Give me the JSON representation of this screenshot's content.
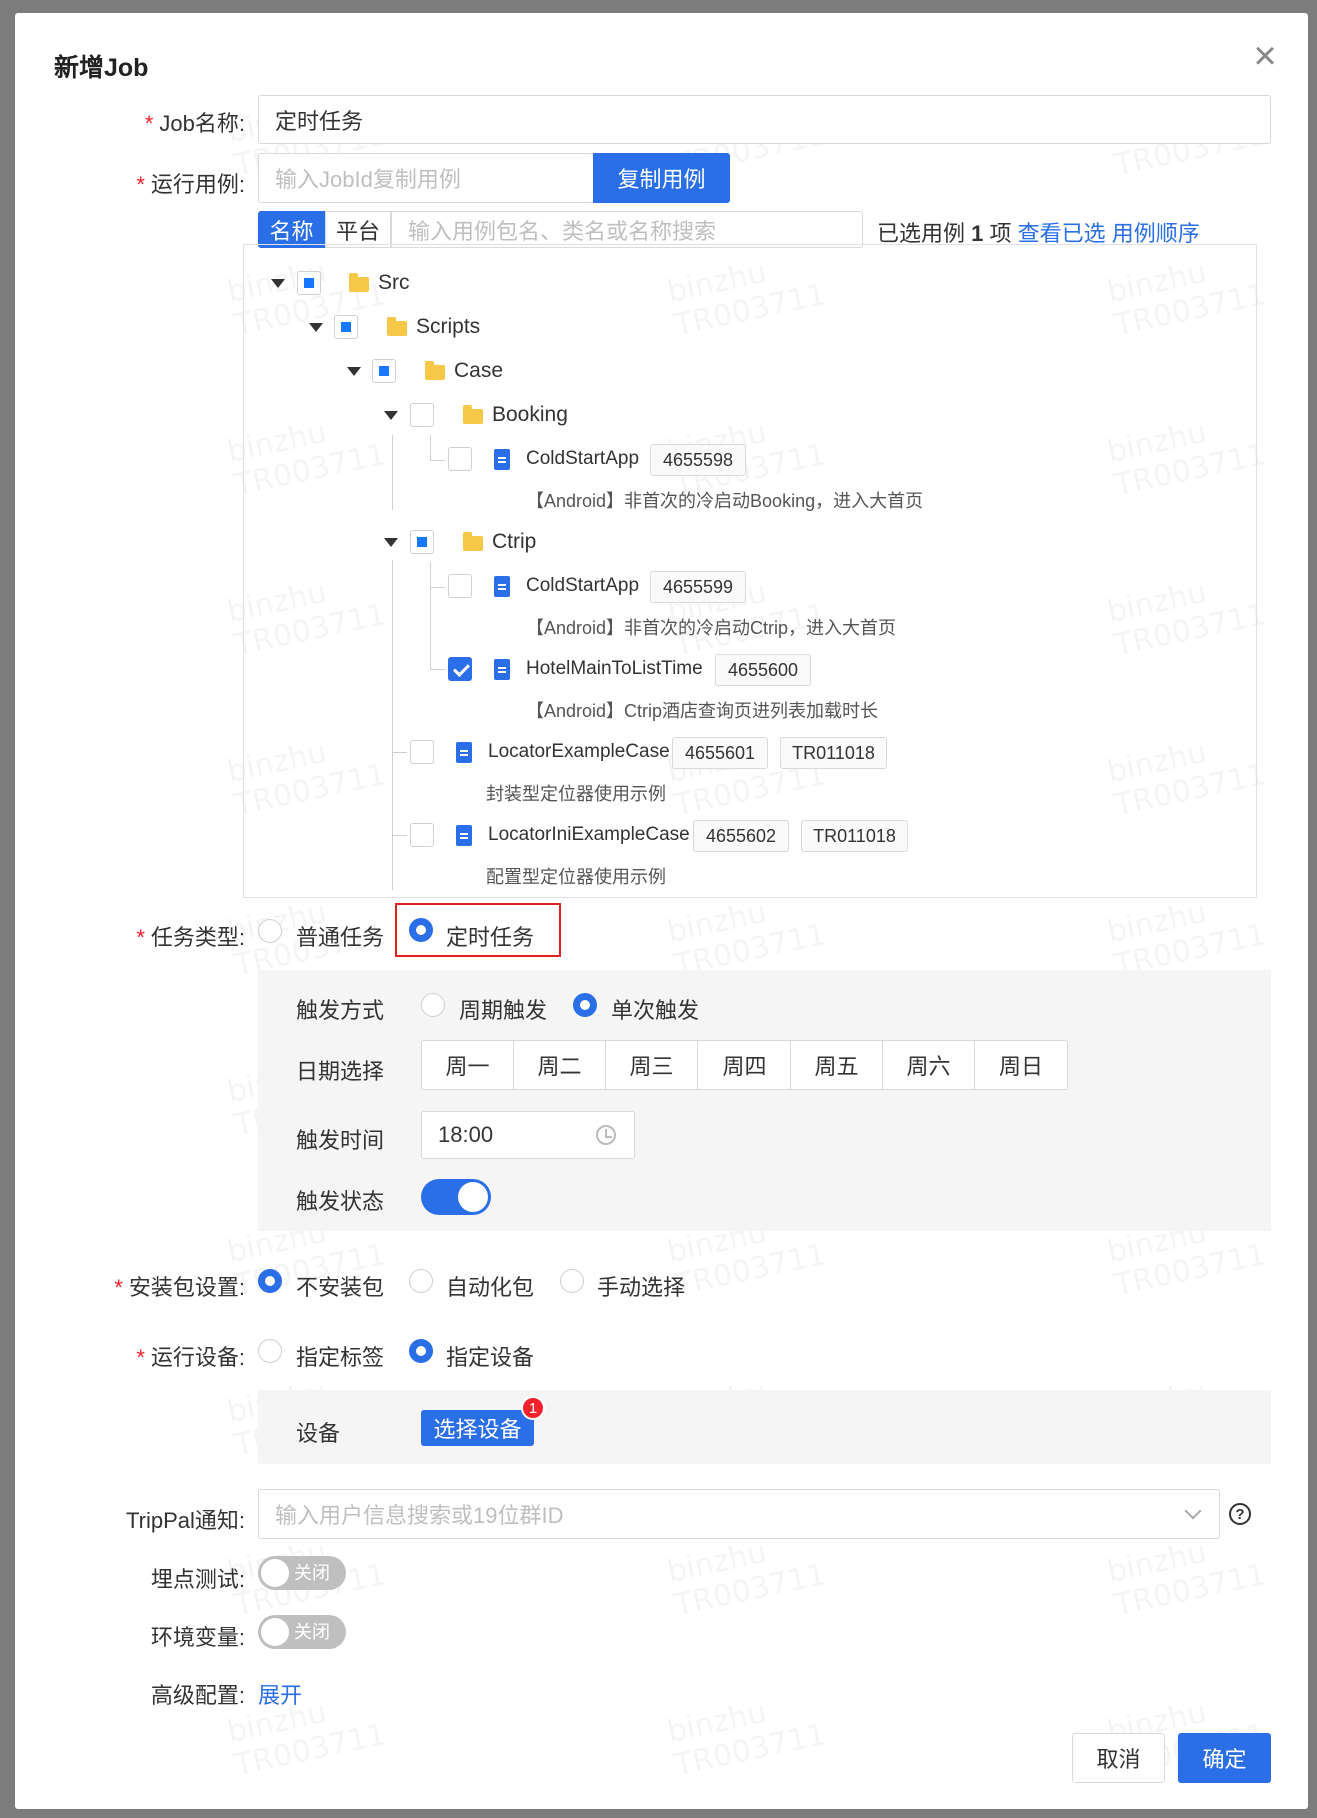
{
  "dialog": {
    "title": "新增Job"
  },
  "job_name": {
    "label": "Job名称:",
    "value": "定时任务"
  },
  "run_case": {
    "label": "运行用例:",
    "placeholder": "输入JobId复制用例",
    "copy_button": "复制用例",
    "tabs": [
      "名称",
      "平台"
    ],
    "active_tab": "名称",
    "search_placeholder": "输入用例包名、类名或名称搜索",
    "selected_prefix": "已选用例",
    "selected_count": "1",
    "selected_suffix": "项",
    "view_selected": "查看已选",
    "case_order": "用例顺序"
  },
  "tree": {
    "src": "Src",
    "scripts": "Scripts",
    "case": "Case",
    "booking": {
      "label": "Booking",
      "item": {
        "name": "ColdStartApp",
        "id": "4655598",
        "desc": "【Android】非首次的冷启动Booking，进入大首页"
      }
    },
    "ctrip": {
      "label": "Ctrip",
      "items": [
        {
          "name": "ColdStartApp",
          "id": "4655599",
          "desc": "【Android】非首次的冷启动Ctrip，进入大首页",
          "checked": false
        },
        {
          "name": "HotelMainToListTime",
          "id": "4655600",
          "desc": "【Android】Ctrip酒店查询页进列表加载时长",
          "checked": true
        }
      ]
    },
    "locators": [
      {
        "name": "LocatorExampleCase",
        "id": "4655601",
        "owner": "TR011018",
        "desc": "封装型定位器使用示例"
      },
      {
        "name": "LocatorIniExampleCase",
        "id": "4655602",
        "owner": "TR011018",
        "desc": "配置型定位器使用示例"
      }
    ]
  },
  "task_type": {
    "label": "任务类型:",
    "options": [
      "普通任务",
      "定时任务"
    ],
    "selected": "定时任务"
  },
  "schedule": {
    "trigger_mode_label": "触发方式",
    "trigger_modes": [
      "周期触发",
      "单次触发"
    ],
    "trigger_mode_selected": "单次触发",
    "date_label": "日期选择",
    "days": [
      "周一",
      "周二",
      "周三",
      "周四",
      "周五",
      "周六",
      "周日"
    ],
    "day_selected": "周四",
    "time_label": "触发时间",
    "time_value": "18:00",
    "state_label": "触发状态",
    "state_on": true
  },
  "package": {
    "label": "安装包设置:",
    "options": [
      "不安装包",
      "自动化包",
      "手动选择"
    ],
    "selected": "不安装包"
  },
  "device": {
    "label": "运行设备:",
    "options": [
      "指定标签",
      "指定设备"
    ],
    "selected": "指定设备",
    "row_label": "设备",
    "select_button": "选择设备",
    "badge": "1"
  },
  "trippal": {
    "label": "TripPal通知:",
    "placeholder": "输入用户信息搜索或19位群ID",
    "help": "?"
  },
  "tracking": {
    "label": "埋点测试:",
    "switch_text": "关闭"
  },
  "env": {
    "label": "环境变量:",
    "switch_text": "关闭"
  },
  "advanced": {
    "label": "高级配置:",
    "expand": "展开"
  },
  "footer": {
    "cancel": "取消",
    "ok": "确定"
  },
  "watermark": {
    "line1": "binzhu",
    "line2": "TR003711"
  },
  "colors": {
    "primary": "#2a6fe8",
    "required": "#f5222d",
    "highlight_box": "#e02020"
  }
}
